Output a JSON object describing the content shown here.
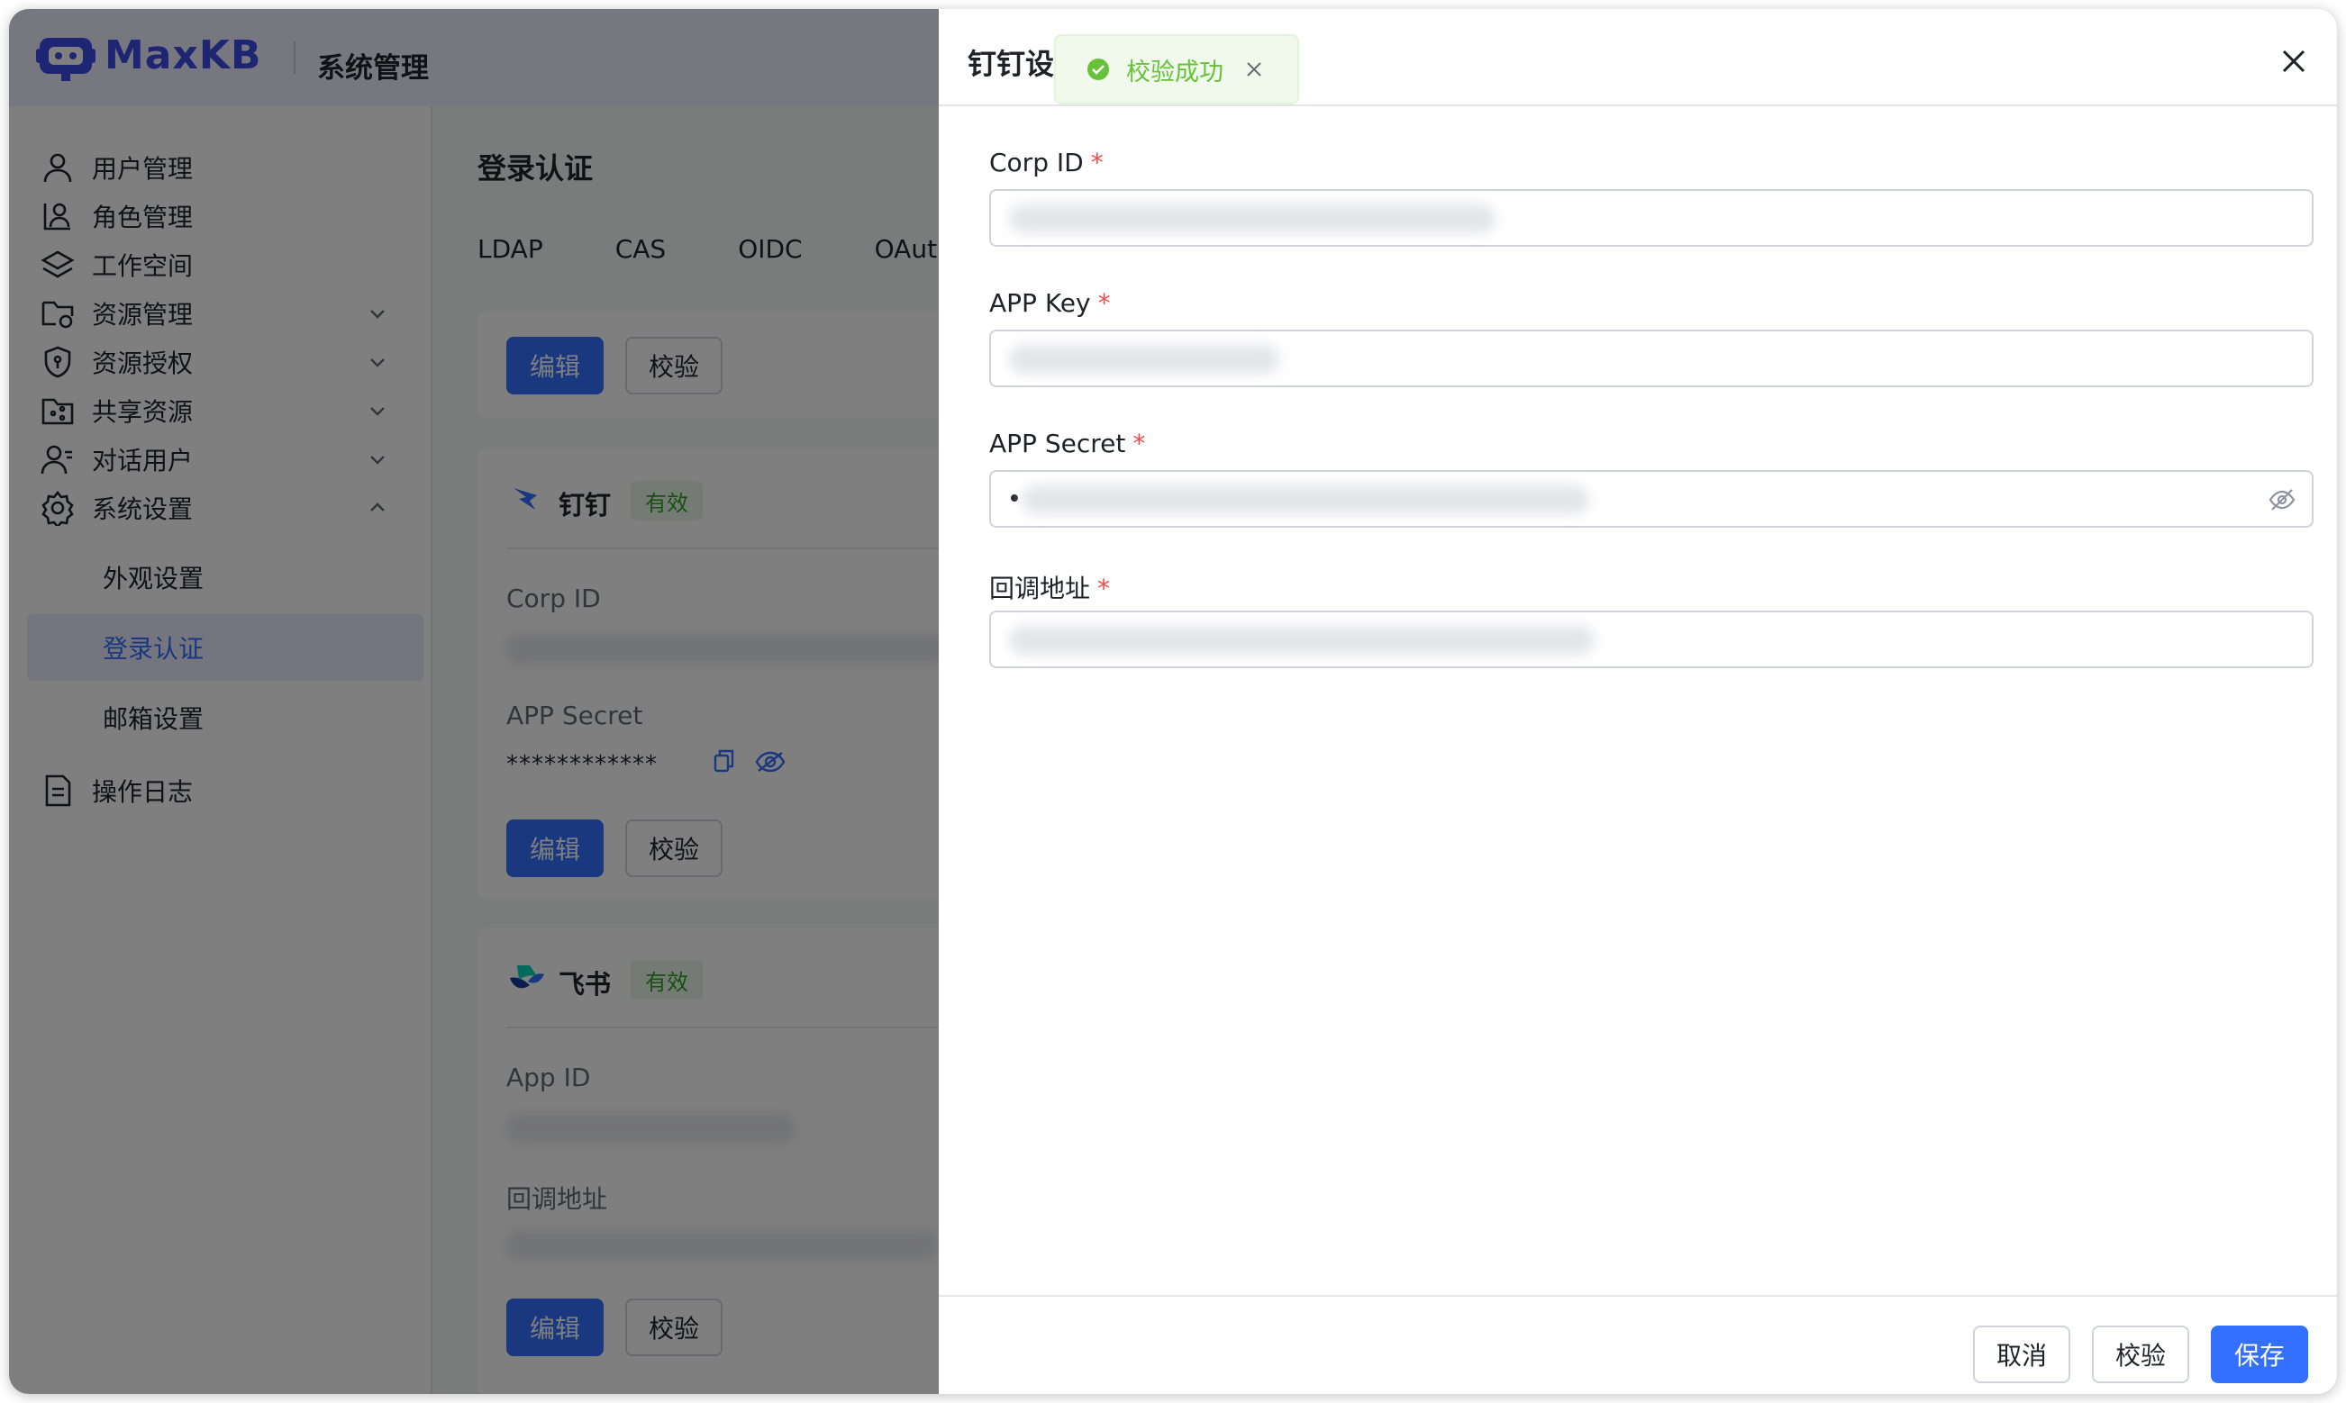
{
  "header": {
    "brand": "MaxKB",
    "section": "系统管理"
  },
  "sidebar": {
    "items": [
      {
        "label": "用户管理",
        "icon": "user-icon"
      },
      {
        "label": "角色管理",
        "icon": "role-icon"
      },
      {
        "label": "工作空间",
        "icon": "layers-icon"
      },
      {
        "label": "资源管理",
        "icon": "folder-settings-icon"
      },
      {
        "label": "资源授权",
        "icon": "shield-icon"
      },
      {
        "label": "共享资源",
        "icon": "shared-folder-icon"
      },
      {
        "label": "对话用户",
        "icon": "chat-user-icon"
      },
      {
        "label": "系统设置",
        "icon": "gear-icon"
      }
    ],
    "sub_items": [
      {
        "label": "外观设置"
      },
      {
        "label": "登录认证"
      },
      {
        "label": "邮箱设置"
      }
    ],
    "bottom_item": {
      "label": "操作日志",
      "icon": "document-icon"
    }
  },
  "main": {
    "title": "登录认证",
    "tabs": [
      "LDAP",
      "CAS",
      "OIDC",
      "OAutl"
    ],
    "edit_label": "编辑",
    "check_label": "校验",
    "dingtalk": {
      "name": "钉钉",
      "status": "有效",
      "corp_label": "Corp ID",
      "secret_label": "APP Secret",
      "secret_masked": "************"
    },
    "feishu": {
      "name": "飞书",
      "status": "有效",
      "app_label": "App ID",
      "callback_label": "回调地址"
    }
  },
  "drawer": {
    "title": "钉钉设",
    "fields": [
      {
        "label": "Corp ID"
      },
      {
        "label": "APP Key"
      },
      {
        "label": "APP Secret"
      },
      {
        "label": "回调地址"
      }
    ],
    "required_mark": "*",
    "buttons": {
      "cancel": "取消",
      "check": "校验",
      "save": "保存"
    }
  },
  "toast": {
    "message": "校验成功"
  },
  "colors": {
    "primary": "#3370ff",
    "brand": "#3d4de8",
    "success": "#67c23a",
    "required": "#f54a45"
  }
}
